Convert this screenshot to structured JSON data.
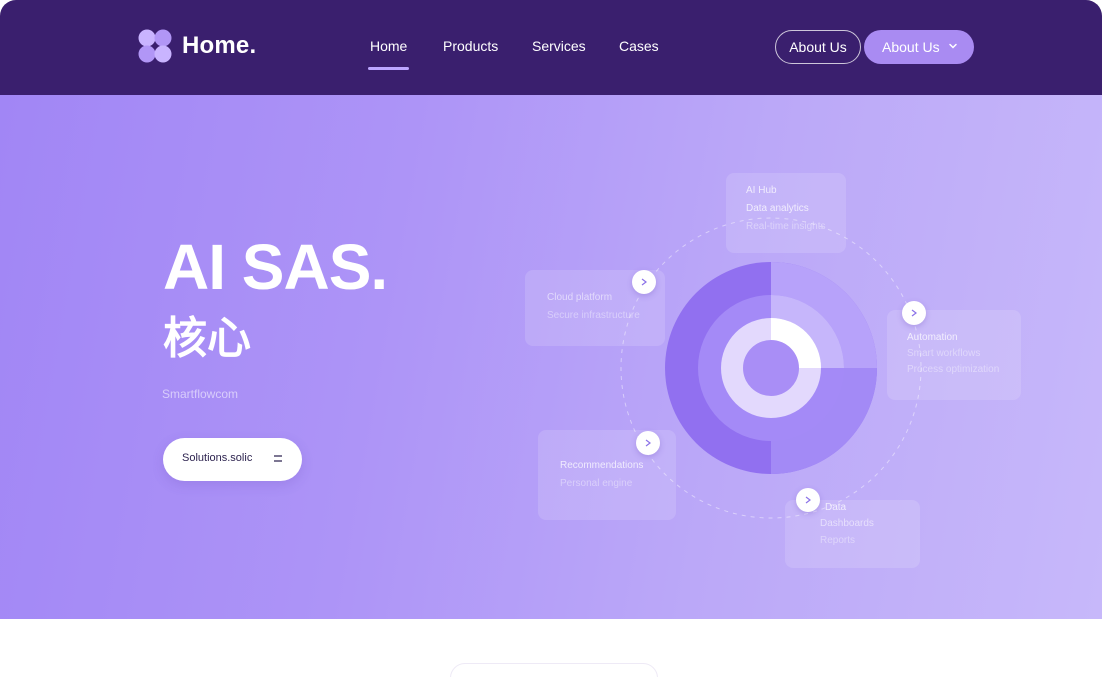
{
  "brand": {
    "name": "Home."
  },
  "nav": {
    "links": [
      {
        "label": "Home",
        "active": true
      },
      {
        "label": "Products",
        "active": false
      },
      {
        "label": "Services",
        "active": false
      },
      {
        "label": "Cases",
        "active": false
      }
    ],
    "about_outline": "About Us",
    "about_dropdown": "About Us"
  },
  "hero": {
    "title": "AI SAS.",
    "subtitle": "核心",
    "caption": "Smartflowcom",
    "cta_label": "Solutions.solic"
  },
  "viz": {
    "cards": [
      {
        "line1": "AI Hub",
        "line2": "Data analytics",
        "line3": "Real-time insights"
      },
      {
        "line1": "Cloud platform",
        "line2": "Secure infrastructure"
      },
      {
        "line1": "Automation",
        "line2": "Smart workflows",
        "line3": "Process optimization"
      },
      {
        "line1": "Recommendations",
        "line2": "Personal engine"
      },
      {
        "line1": "Data",
        "line2": "Dashboards",
        "line3": "Reports"
      }
    ]
  },
  "colors": {
    "nav_bg": "#3a1f6e",
    "accent": "#a98bf2",
    "hero_start": "#a186f5",
    "hero_end": "#c7b8fa",
    "ring_dark": "#9170f0",
    "ring_light": "#e3d9fd"
  },
  "icons": [
    "logo-flower-icon",
    "chevron-down-icon",
    "menu-lines-icon",
    "arrow-right-icon"
  ]
}
